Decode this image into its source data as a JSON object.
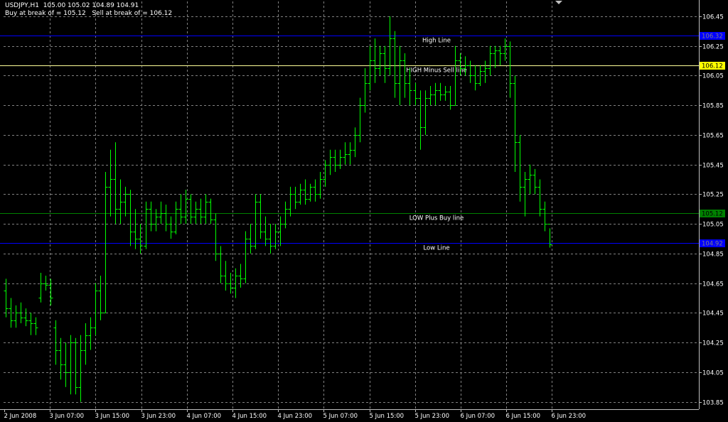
{
  "header": {
    "symbol_line": "USDJPY,H1  105.00 105.02 104.89 104.91",
    "buy_label": "Buy at break of = 105.12",
    "sell_label": "Sell at break of = 106.12"
  },
  "colors": {
    "background": "#000000",
    "grid": "#808080",
    "bars": "#00ff00",
    "axis": "#c0c0c0",
    "high_line": "#0000ff",
    "sell_line": "#ffff99",
    "buy_line": "#008000",
    "low_line": "#0000ff"
  },
  "chart_data": {
    "type": "ohlc",
    "symbol": "USDJPY",
    "timeframe": "H1",
    "ylim": [
      103.8,
      106.55
    ],
    "y_ticks": [
      "106.45",
      "106.25",
      "106.05",
      "105.85",
      "105.65",
      "105.45",
      "105.25",
      "105.05",
      "104.85",
      "104.65",
      "104.45",
      "104.25",
      "104.05",
      "103.85"
    ],
    "x_labels": [
      "2 Jun 2008",
      "3 Jun 07:00",
      "3 Jun 15:00",
      "3 Jun 23:00",
      "4 Jun 07:00",
      "4 Jun 15:00",
      "4 Jun 23:00",
      "5 Jun 07:00",
      "5 Jun 15:00",
      "5 Jun 23:00",
      "6 Jun 07:00",
      "6 Jun 15:00",
      "6 Jun 23:00"
    ],
    "levels": [
      {
        "key": "high",
        "label": "High Line",
        "value": 106.32,
        "tag": "106.32",
        "color": "#0000ff",
        "tag_bg": "#0000ff",
        "tag_fg": "#808080"
      },
      {
        "key": "sell",
        "label": "HIGH Minus Sell line",
        "value": 106.12,
        "tag": "106.12",
        "color": "#ffff99",
        "tag_bg": "#ffff00",
        "tag_fg": "#000000"
      },
      {
        "key": "buy",
        "label": "LOW Plus Buy line",
        "value": 105.12,
        "tag": "105.12",
        "color": "#008000",
        "tag_bg": "#008000",
        "tag_fg": "#000000"
      },
      {
        "key": "low",
        "label": "Low Line",
        "value": 104.92,
        "tag": "104.92",
        "color": "#0000ff",
        "tag_bg": "#0000ff",
        "tag_fg": "#808080"
      }
    ],
    "bars": [
      [
        104.6,
        104.68,
        104.42,
        104.48
      ],
      [
        104.48,
        104.55,
        104.35,
        104.4
      ],
      [
        104.4,
        104.5,
        104.35,
        104.45
      ],
      [
        104.45,
        104.52,
        104.38,
        104.42
      ],
      [
        104.42,
        104.48,
        104.36,
        104.4
      ],
      [
        104.4,
        104.45,
        104.3,
        104.38
      ],
      [
        104.38,
        104.42,
        104.3,
        104.35
      ],
      [
        104.55,
        104.72,
        104.52,
        104.65
      ],
      [
        104.65,
        104.7,
        104.6,
        104.64
      ],
      [
        104.64,
        104.68,
        104.5,
        104.55
      ],
      [
        104.35,
        104.4,
        104.1,
        104.2
      ],
      [
        104.2,
        104.28,
        104.0,
        104.1
      ],
      [
        104.1,
        104.25,
        103.95,
        104.05
      ],
      [
        104.05,
        104.3,
        103.9,
        104.25
      ],
      [
        104.25,
        104.28,
        103.9,
        103.95
      ],
      [
        103.95,
        104.3,
        103.85,
        104.2
      ],
      [
        104.2,
        104.38,
        104.1,
        104.3
      ],
      [
        104.3,
        104.42,
        104.2,
        104.35
      ],
      [
        104.35,
        104.65,
        104.3,
        104.6
      ],
      [
        104.6,
        104.7,
        104.4,
        104.45
      ],
      [
        104.45,
        105.4,
        104.45,
        105.3
      ],
      [
        105.3,
        105.55,
        105.1,
        105.35
      ],
      [
        105.35,
        105.6,
        105.05,
        105.15
      ],
      [
        105.15,
        105.35,
        105.05,
        105.2
      ],
      [
        105.2,
        105.3,
        105.1,
        105.25
      ],
      [
        105.25,
        105.28,
        104.9,
        105.0
      ],
      [
        105.0,
        105.15,
        104.88,
        104.95
      ],
      [
        104.95,
        105.05,
        104.85,
        104.9
      ],
      [
        104.9,
        105.2,
        104.88,
        105.15
      ],
      [
        105.15,
        105.2,
        105.0,
        105.05
      ],
      [
        105.05,
        105.15,
        105.0,
        105.1
      ],
      [
        105.1,
        105.2,
        105.05,
        105.12
      ],
      [
        105.12,
        105.18,
        105.0,
        105.05
      ],
      [
        105.05,
        105.1,
        104.95,
        105.0
      ],
      [
        105.0,
        105.2,
        104.98,
        105.15
      ],
      [
        105.15,
        105.25,
        105.05,
        105.1
      ],
      [
        105.1,
        105.28,
        105.05,
        105.22
      ],
      [
        105.22,
        105.25,
        105.05,
        105.1
      ],
      [
        105.1,
        105.2,
        105.05,
        105.15
      ],
      [
        105.15,
        105.22,
        105.05,
        105.1
      ],
      [
        105.1,
        105.25,
        105.05,
        105.2
      ],
      [
        105.2,
        105.22,
        105.05,
        105.08
      ],
      [
        105.08,
        105.12,
        104.8,
        104.85
      ],
      [
        104.85,
        104.9,
        104.65,
        104.7
      ],
      [
        104.7,
        104.8,
        104.6,
        104.65
      ],
      [
        104.65,
        104.72,
        104.58,
        104.62
      ],
      [
        104.62,
        104.75,
        104.55,
        104.7
      ],
      [
        104.7,
        104.78,
        104.62,
        104.68
      ],
      [
        104.68,
        105.0,
        104.65,
        104.95
      ],
      [
        104.95,
        105.05,
        104.85,
        104.9
      ],
      [
        104.9,
        105.25,
        104.88,
        105.2
      ],
      [
        105.2,
        105.25,
        104.95,
        105.0
      ],
      [
        105.0,
        105.1,
        104.9,
        104.95
      ],
      [
        104.95,
        105.05,
        104.85,
        104.9
      ],
      [
        104.9,
        105.05,
        104.88,
        105.0
      ],
      [
        105.0,
        105.1,
        104.9,
        105.05
      ],
      [
        105.05,
        105.2,
        105.02,
        105.15
      ],
      [
        105.15,
        105.3,
        105.1,
        105.25
      ],
      [
        105.25,
        105.3,
        105.15,
        105.2
      ],
      [
        105.2,
        105.32,
        105.18,
        105.28
      ],
      [
        105.28,
        105.35,
        105.18,
        105.22
      ],
      [
        105.22,
        105.32,
        105.2,
        105.3
      ],
      [
        105.3,
        105.35,
        105.2,
        105.25
      ],
      [
        105.25,
        105.4,
        105.22,
        105.35
      ],
      [
        105.35,
        105.48,
        105.3,
        105.45
      ],
      [
        105.45,
        105.55,
        105.38,
        105.5
      ],
      [
        105.5,
        105.55,
        105.4,
        105.45
      ],
      [
        105.45,
        105.55,
        105.42,
        105.5
      ],
      [
        105.5,
        105.6,
        105.45,
        105.52
      ],
      [
        105.52,
        105.6,
        105.45,
        105.55
      ],
      [
        105.55,
        105.7,
        105.5,
        105.65
      ],
      [
        105.65,
        105.9,
        105.6,
        105.85
      ],
      [
        105.85,
        106.1,
        105.8,
        106.0
      ],
      [
        106.0,
        106.25,
        105.95,
        106.15
      ],
      [
        106.15,
        106.3,
        106.0,
        106.1
      ],
      [
        106.1,
        106.25,
        106.05,
        106.2
      ],
      [
        106.2,
        106.25,
        106.0,
        106.1
      ],
      [
        106.1,
        106.45,
        106.05,
        106.3
      ],
      [
        106.3,
        106.35,
        105.9,
        106.0
      ],
      [
        106.0,
        106.25,
        105.85,
        106.15
      ],
      [
        106.15,
        106.2,
        105.9,
        106.0
      ],
      [
        106.0,
        106.1,
        105.85,
        105.95
      ],
      [
        105.95,
        106.0,
        105.85,
        105.9
      ],
      [
        105.9,
        105.95,
        105.55,
        105.7
      ],
      [
        105.7,
        105.95,
        105.65,
        105.9
      ],
      [
        105.9,
        105.98,
        105.85,
        105.92
      ],
      [
        105.92,
        106.0,
        105.85,
        105.95
      ],
      [
        105.95,
        106.0,
        105.88,
        105.92
      ],
      [
        105.92,
        105.98,
        105.88,
        105.94
      ],
      [
        105.94,
        105.98,
        105.82,
        105.85
      ],
      [
        105.85,
        106.25,
        105.85,
        106.15
      ],
      [
        106.15,
        106.2,
        106.05,
        106.1
      ],
      [
        106.1,
        106.18,
        106.05,
        106.12
      ],
      [
        106.12,
        106.15,
        106.0,
        106.05
      ],
      [
        106.05,
        106.12,
        105.95,
        106.0
      ],
      [
        106.0,
        106.12,
        105.98,
        106.08
      ],
      [
        106.08,
        106.15,
        106.0,
        106.1
      ],
      [
        106.1,
        106.25,
        106.05,
        106.2
      ],
      [
        106.2,
        106.25,
        106.1,
        106.22
      ],
      [
        106.22,
        106.25,
        106.12,
        106.2
      ],
      [
        106.2,
        106.3,
        106.15,
        106.25
      ],
      [
        106.25,
        106.28,
        105.9,
        106.0
      ],
      [
        106.0,
        106.05,
        105.4,
        105.6
      ],
      [
        105.6,
        105.65,
        105.2,
        105.3
      ],
      [
        105.3,
        105.4,
        105.1,
        105.35
      ],
      [
        105.35,
        105.45,
        105.25,
        105.38
      ],
      [
        105.38,
        105.42,
        105.25,
        105.3
      ],
      [
        105.3,
        105.35,
        105.1,
        105.15
      ],
      [
        105.15,
        105.2,
        105.0,
        105.05
      ],
      [
        105.05,
        105.02,
        104.89,
        104.91
      ]
    ]
  }
}
